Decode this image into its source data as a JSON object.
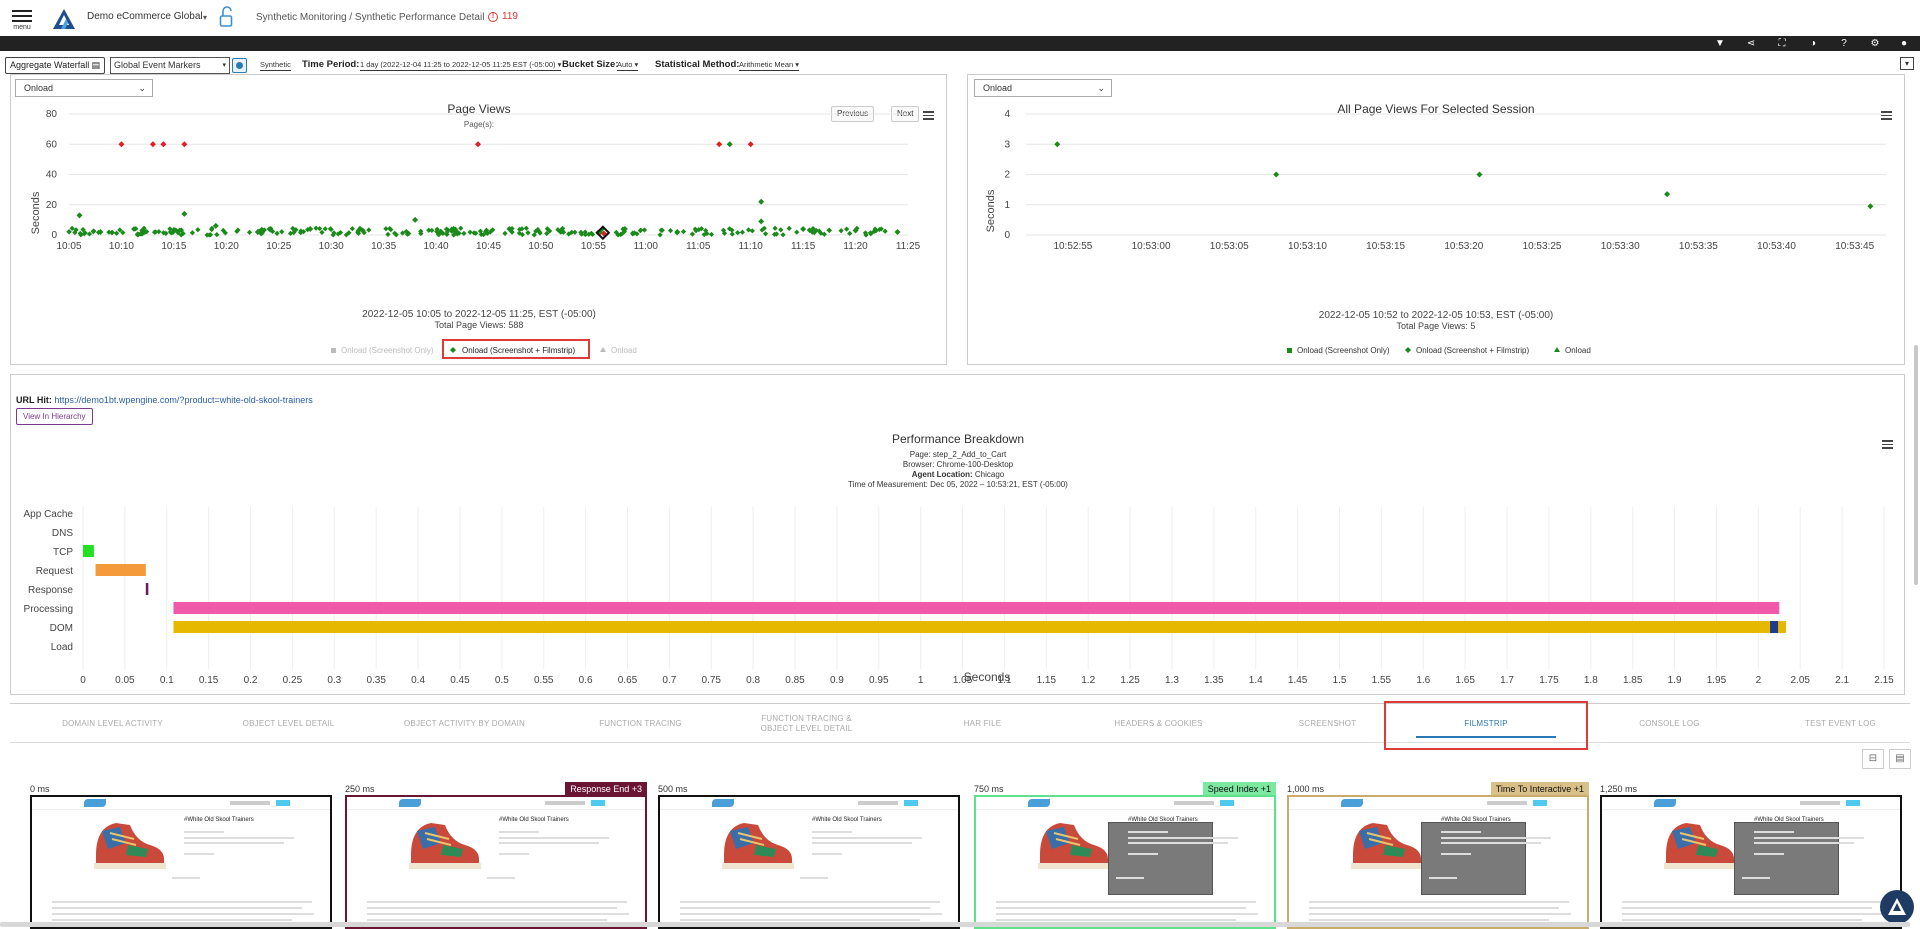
{
  "header": {
    "menu_label": "menu",
    "app_name": "Demo eCommerce Global",
    "breadcrumb": "Synthetic Monitoring / Synthetic Performance Detail",
    "alert_count": "119",
    "toolbar_icons": [
      "filter-icon",
      "share-icon",
      "fullscreen-icon",
      "contrast-icon",
      "help-icon",
      "settings-icon",
      "user-icon"
    ]
  },
  "filters": {
    "aggregate_waterfall": "Aggregate Waterfall",
    "event_markers": "Global Event Markers",
    "synthetic": "Synthetic",
    "time_period_label": "Time Period:",
    "time_period_value": "1 day (2022-12-04 11:25 to 2022-12-05 11:25 EST (-05:00)",
    "bucket_label": "Bucket Size:",
    "bucket_value": "Auto",
    "stat_label": "Statistical Method:",
    "stat_value": "Arithmetic Mean"
  },
  "page_views": {
    "dropdown": "Onload",
    "title": "Page Views",
    "subtitle": "Page(s):",
    "prev": "Previous",
    "next": "Next",
    "ylabel": "Seconds",
    "yticks": [
      "0",
      "20",
      "40",
      "60",
      "80"
    ],
    "xticks": [
      "10:05",
      "10:10",
      "10:15",
      "10:20",
      "10:25",
      "10:30",
      "10:35",
      "10:40",
      "10:45",
      "10:50",
      "10:55",
      "11:00",
      "11:05",
      "11:10",
      "11:15",
      "11:20",
      "11:25"
    ],
    "range": "2022-12-05 10:05 to 2022-12-05 11:25, EST (-05:00)",
    "total": "Total Page Views: 588",
    "legend": [
      "Onload (Screenshot Only)",
      "Onload (Screenshot + Filmstrip)",
      "Onload"
    ]
  },
  "session_views": {
    "dropdown": "Onload",
    "title": "All Page Views For Selected Session",
    "ylabel": "Seconds",
    "yticks": [
      "0",
      "1",
      "2",
      "3",
      "4"
    ],
    "xticks": [
      "10:52:55",
      "10:53:00",
      "10:53:05",
      "10:53:10",
      "10:53:15",
      "10:53:20",
      "10:53:25",
      "10:53:30",
      "10:53:35",
      "10:53:40",
      "10:53:45"
    ],
    "range": "2022-12-05 10:52 to 2022-12-05 10:53, EST (-05:00)",
    "total": "Total Page Views: 5",
    "legend": [
      "Onload (Screenshot Only)",
      "Onload (Screenshot + Filmstrip)",
      "Onload"
    ]
  },
  "url": {
    "label": "URL Hit:",
    "value": "https://demo1bt.wpengine.com/?product=white-old-skool-trainers",
    "hierarchy_button": "View In Hierarchy"
  },
  "breakdown": {
    "title": "Performance Breakdown",
    "page": "Page: step_2_Add_to_Cart",
    "browser": "Browser: Chrome-100-Desktop",
    "agent_label": "Agent Location:",
    "agent_value": "Chicago",
    "time": "Time of Measurement: Dec 05, 2022 – 10:53:21, EST (-05:00)",
    "xlabel": "Seconds"
  },
  "chart_data": [
    {
      "type": "scatter",
      "title": "Page Views",
      "subtitle": "Page(s):",
      "ylabel": "Seconds",
      "ylim": [
        0,
        80
      ],
      "xlim": [
        "10:05",
        "11:25"
      ],
      "series": [
        {
          "name": "Onload (Screenshot + Filmstrip)",
          "color": "#1a8a1a",
          "x": [
            "10:06",
            "10:08",
            "10:12",
            "10:16",
            "10:19",
            "10:23",
            "10:28",
            "10:33",
            "10:38",
            "10:42",
            "10:47",
            "10:52",
            "10:58",
            "11:03",
            "11:08",
            "11:11",
            "11:11",
            "11:15",
            "11:20",
            "11:24"
          ],
          "y": [
            13,
            2,
            3,
            14,
            6,
            2,
            4,
            3,
            10,
            2,
            4,
            3,
            4,
            2,
            60,
            9,
            22,
            4,
            3,
            2
          ]
        },
        {
          "name": "Onload",
          "color": "#e02020",
          "x": [
            "10:10",
            "10:13",
            "10:14",
            "10:16",
            "10:44",
            "11:07",
            "11:10",
            "10:56"
          ],
          "y": [
            60,
            60,
            60,
            60,
            60,
            60,
            60,
            1
          ]
        }
      ]
    },
    {
      "type": "scatter",
      "title": "All Page Views For Selected Session",
      "ylabel": "Seconds",
      "ylim": [
        0,
        4
      ],
      "series": [
        {
          "name": "Onload (Screenshot + Filmstrip)",
          "color": "#1a8a1a",
          "x": [
            "10:52:54",
            "10:53:08",
            "10:53:21",
            "10:53:33",
            "10:53:46"
          ],
          "y": [
            3.0,
            2.0,
            2.0,
            1.35,
            0.95
          ]
        }
      ]
    },
    {
      "type": "bar",
      "orientation": "horizontal",
      "title": "Performance Breakdown",
      "xlabel": "Seconds",
      "xlim": [
        0,
        2.15
      ],
      "categories": [
        "App Cache",
        "DNS",
        "TCP",
        "Request",
        "Response",
        "Processing",
        "DOM",
        "Load"
      ],
      "ranges": [
        {
          "category": "TCP",
          "start": 0.0,
          "end": 0.013,
          "color": "#22e022"
        },
        {
          "category": "Request",
          "start": 0.015,
          "end": 0.075,
          "color": "#f59a3a"
        },
        {
          "category": "Response",
          "start": 0.075,
          "end": 0.078,
          "color": "#6b1a5a"
        },
        {
          "category": "Processing",
          "start": 0.108,
          "end": 2.025,
          "color": "#f05aa8"
        },
        {
          "category": "DOM",
          "start": 0.108,
          "end": 2.033,
          "color": "#e6b800"
        }
      ]
    }
  ],
  "tabs": [
    {
      "label": "DOMAIN LEVEL ACTIVITY"
    },
    {
      "label": "OBJECT LEVEL DETAIL"
    },
    {
      "label": "OBJECT ACTIVITY BY DOMAIN"
    },
    {
      "label": "FUNCTION TRACING"
    },
    {
      "label": "FUNCTION TRACING & OBJECT LEVEL DETAIL"
    },
    {
      "label": "HAR FILE"
    },
    {
      "label": "HEADERS & COOKIES"
    },
    {
      "label": "SCREENSHOT"
    },
    {
      "label": "FILMSTRIP",
      "active": true
    },
    {
      "label": "CONSOLE LOG"
    },
    {
      "label": "TEST EVENT LOG"
    }
  ],
  "filmstrip": {
    "page_title": "#White Old Skool Trainers",
    "frames": [
      {
        "time": "0 ms",
        "badge": "",
        "badge_color": "",
        "border": "#111"
      },
      {
        "time": "250 ms",
        "badge": "Response End +3",
        "badge_color": "#6b1535",
        "border": "#6b1535"
      },
      {
        "time": "500 ms",
        "badge": "",
        "badge_color": "",
        "border": "#111"
      },
      {
        "time": "750 ms",
        "badge": "Speed Index +1",
        "badge_color": "#7de8a0",
        "border": "#5fe08a"
      },
      {
        "time": "1,000 ms",
        "badge": "Time To Interactive +1",
        "badge_color": "#d8c088",
        "border": "#c9ac6c"
      },
      {
        "time": "1,250 ms",
        "badge": "",
        "badge_color": "",
        "border": "#111"
      }
    ]
  }
}
